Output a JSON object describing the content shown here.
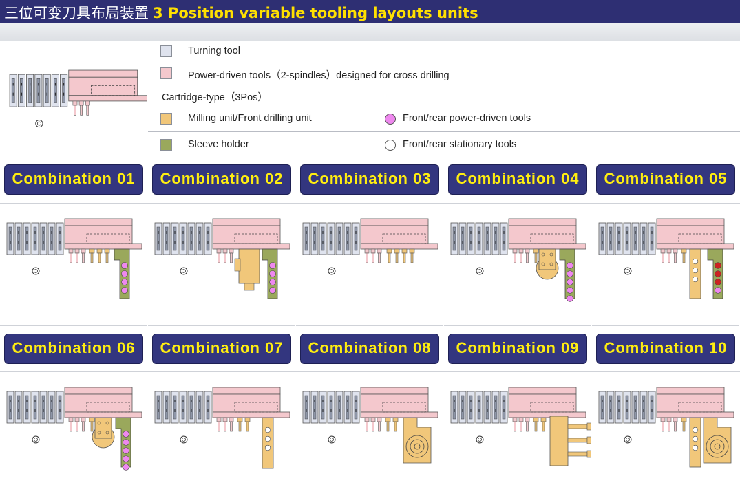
{
  "header": {
    "title_cn": "三位可变刀具布局装置",
    "title_en": "3 Position variable tooling layouts units"
  },
  "legend": {
    "turning_tool": "Turning  tool",
    "power_driven_tools": "Power-driven tools（2-spindles）designed for cross drilling",
    "cartridge_type": "Cartridge-type（3Pos）",
    "milling_unit": "Milling unit/Front drilling unit",
    "front_rear_power": "Front/rear power-driven tools",
    "sleeve_holder": "Sleeve holder",
    "front_rear_stationary": "Front/rear stationary tools"
  },
  "colors": {
    "header_bg": "#2e2f73",
    "combo_bg": "#33367f",
    "combo_text": "#ffee10",
    "turning_tool": "#dfe3ee",
    "power_driven": "#f4c8cd",
    "milling_unit": "#f1c77a",
    "sleeve_holder": "#9aa85c",
    "power_dot": "#ee88ee",
    "stationary_dot": "#ffffff",
    "red_dot": "#cc2222"
  },
  "combinations": [
    {
      "label": "Combination 01",
      "variant": "sleeve-pink"
    },
    {
      "label": "Combination 02",
      "variant": "milling-vertical-sleeve-pink"
    },
    {
      "label": "Combination 03",
      "variant": "plain"
    },
    {
      "label": "Combination 04",
      "variant": "round-milling-sleeve-pink"
    },
    {
      "label": "Combination 05",
      "variant": "milling-white-sleeve-red"
    },
    {
      "label": "Combination 06",
      "variant": "round-milling-sleeve-pink"
    },
    {
      "label": "Combination 07",
      "variant": "milling-white"
    },
    {
      "label": "Combination 08",
      "variant": "motor-milling"
    },
    {
      "label": "Combination 09",
      "variant": "multi-spindle-block"
    },
    {
      "label": "Combination 10",
      "variant": "milling-white-motor"
    }
  ]
}
